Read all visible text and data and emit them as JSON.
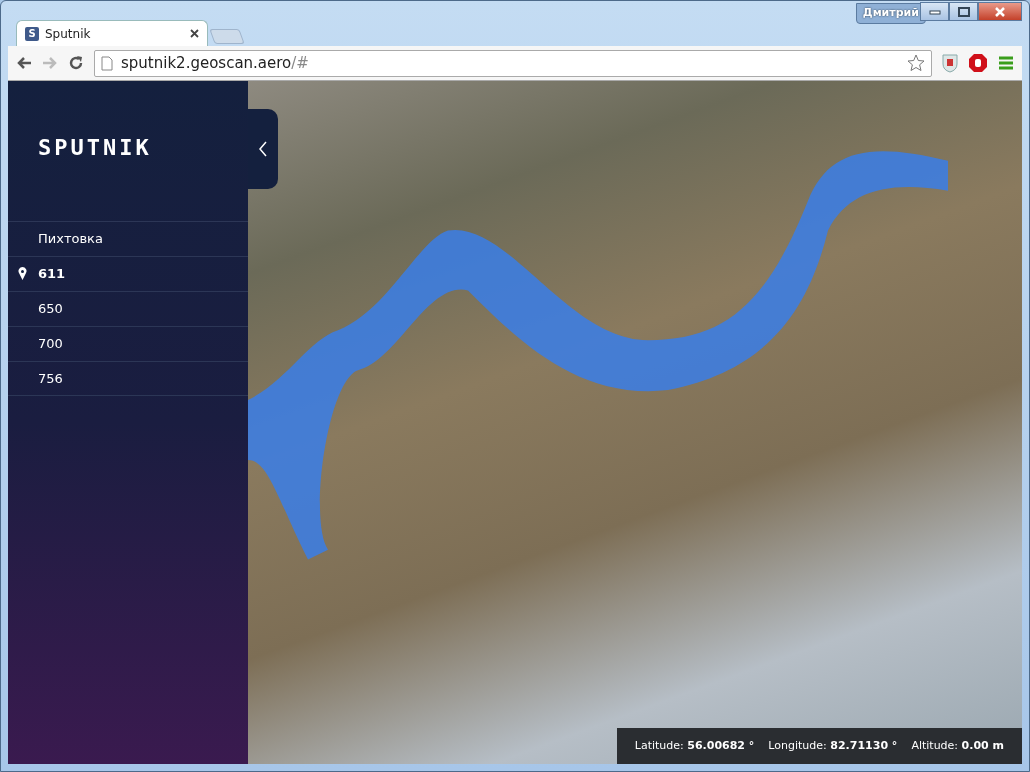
{
  "window": {
    "user": "Дмитрий"
  },
  "tabs": [
    {
      "title": "Sputnik",
      "favicon": "S",
      "selected": true
    }
  ],
  "address_bar": {
    "host": "sputnik2.geoscan.aero",
    "path": "/#"
  },
  "sidebar": {
    "logo": "SPUTNIK",
    "items": [
      {
        "label": "Пихтовка",
        "selected": false
      },
      {
        "label": "611",
        "selected": true
      },
      {
        "label": "650",
        "selected": false
      },
      {
        "label": "700",
        "selected": false
      },
      {
        "label": "756",
        "selected": false
      }
    ]
  },
  "status_bar": [
    {
      "label": "Latitude:",
      "value": "56.00682 °"
    },
    {
      "label": "Longitude:",
      "value": "82.71130 °"
    },
    {
      "label": "Altitude:",
      "value": "0.00 m"
    }
  ]
}
